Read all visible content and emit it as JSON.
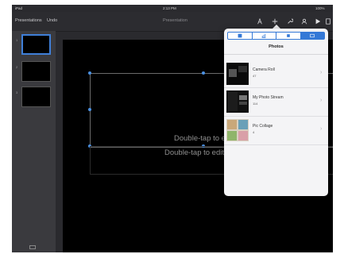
{
  "status_bar": {
    "carrier": "iPad",
    "time": "2:13 PM",
    "battery": "100%"
  },
  "toolbar": {
    "back_label": "Presentations",
    "undo_label": "Undo",
    "doc_title": "Presentation",
    "icons": [
      "share-icon",
      "add-icon",
      "wrench-icon",
      "user-icon",
      "play-icon",
      "more-icon"
    ]
  },
  "navigator": {
    "slides": [
      {
        "number": "1"
      },
      {
        "number": "2"
      },
      {
        "number": "3"
      }
    ],
    "selected_slide": "1"
  },
  "slide": {
    "placeholder_primary": "Double-tap to edit",
    "placeholder_secondary": "Double-tap to edit"
  },
  "popover": {
    "tab_icons": [
      "table-icon",
      "chart-icon",
      "shape-icon",
      "media-icon"
    ],
    "selected_tab": "media-icon",
    "title": "Photos",
    "albums": [
      {
        "name": "Camera Roll",
        "count": "47"
      },
      {
        "name": "My Photo Stream",
        "count": "114"
      },
      {
        "name": "Pic Collage",
        "count": "4"
      }
    ]
  },
  "colors": {
    "accent": "#3478d6",
    "handle": "#4a90e2",
    "canvas": "#000000",
    "chrome": "#2c2c30"
  }
}
